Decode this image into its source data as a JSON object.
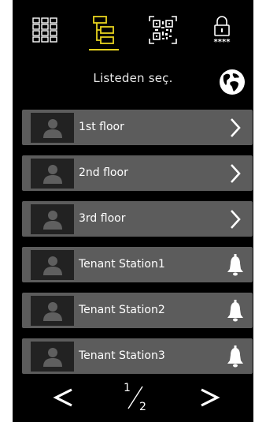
{
  "tabs": [
    {
      "id": "keypad",
      "icon": "keypad-grid-icon",
      "active": false
    },
    {
      "id": "list",
      "icon": "directory-list-icon",
      "active": true
    },
    {
      "id": "qr",
      "icon": "qr-code-icon",
      "active": false
    },
    {
      "id": "pin",
      "icon": "lock-pin-icon",
      "active": false
    }
  ],
  "pin_mask": "****",
  "header": {
    "title": "Listeden seç.",
    "language_icon": "globe-icon"
  },
  "list": {
    "items": [
      {
        "label": "1st floor",
        "action": "chevron-right-icon"
      },
      {
        "label": "2nd floor",
        "action": "chevron-right-icon"
      },
      {
        "label": "3rd floor",
        "action": "chevron-right-icon"
      },
      {
        "label": "Tenant Station1",
        "action": "bell-icon"
      },
      {
        "label": "Tenant Station2",
        "action": "bell-icon"
      },
      {
        "label": "Tenant Station3",
        "action": "bell-icon"
      }
    ]
  },
  "pager": {
    "current": "1",
    "total": "2",
    "prev_icon": "chevron-left-icon",
    "next_icon": "chevron-right-icon"
  },
  "colors": {
    "accent": "#e6d21e",
    "row_bg": "#5c5c5c",
    "avatar_bg": "#222222",
    "background": "#000000"
  }
}
